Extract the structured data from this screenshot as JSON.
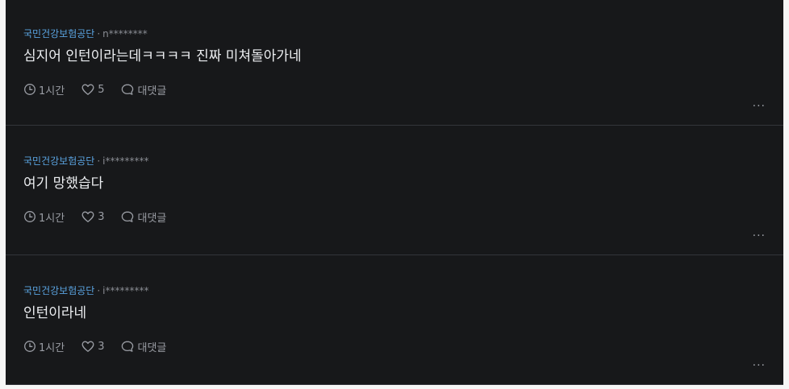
{
  "comments": [
    {
      "company": "국민건강보험공단",
      "user": "n********",
      "text": "심지어 인턴이라는데ㅋㅋㅋㅋ 진짜 미쳐돌아가네",
      "time": "1시간",
      "likes": "5",
      "reply_label": "대댓글"
    },
    {
      "company": "국민건강보험공단",
      "user": "i*********",
      "text": "여기 망했습다",
      "time": "1시간",
      "likes": "3",
      "reply_label": "대댓글"
    },
    {
      "company": "국민건강보험공단",
      "user": "i*********",
      "text": "인턴이라네",
      "time": "1시간",
      "likes": "3",
      "reply_label": "대댓글"
    }
  ],
  "separator": "·",
  "more_label": "...",
  "icons": {
    "time": "clock-icon",
    "likes": "heart-icon",
    "reply": "speech-bubble-icon",
    "more": "more-options-icon"
  },
  "colors": {
    "background": "#17181a",
    "company": "#5aa3e0",
    "text": "#eceef1",
    "meta": "#8a8d94"
  }
}
